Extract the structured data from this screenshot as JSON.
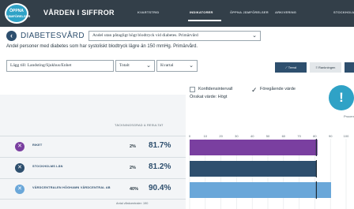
{
  "brand": {
    "logo_line1": "ÖPPNA",
    "logo_line2": "JÄMFÖRELSER"
  },
  "header": {
    "title": "VÅRDEN I SIFFROR",
    "nav": [
      "KVARTSTRID",
      "INDIKATORER",
      "ÖPPNA JÄMFÖRELSER",
      "ARKIVERING",
      "STOCKHOLMS"
    ]
  },
  "page": {
    "title": "DIABETESVÅRD",
    "indicator": "Andel utan påtagligt högt blodtryck vid diabetes. Primärvård",
    "subtitle": "Andel personer med diabetes som har systoliskt blodtryck lägre än 150 mmHg. Primärvård."
  },
  "filters": {
    "unit_placeholder": "Lägg till: Landsting/Sjukhus/Enhet",
    "gender": "Totalt",
    "period": "Kvartal"
  },
  "toolbar": {
    "trend_label": "Trend",
    "ranking_label": "Rankningen"
  },
  "options": {
    "confidence_label": "Konfidensintervall",
    "previous_label": "Föregående värde",
    "desired_value": "Önskat värde: Högt",
    "info_glyph": "!"
  },
  "table": {
    "column_header": "TÄCKNINGSGRAD & RESULTAT",
    "rows": [
      {
        "label": "RIKET",
        "share": "2%",
        "value": "81.7%",
        "color": "#7a3fa0",
        "icon": "close-icon"
      },
      {
        "label": "STOCKHOLMS LÄN",
        "share": "2%",
        "value": "81.2%",
        "color": "#2e4f6e",
        "icon": "close-icon"
      },
      {
        "label": "VÅRDCENTRALEN HÖGHAMN VÅRDCENTRAL AB",
        "share": "40%",
        "value": "90.4%",
        "color": "#6aa7d9",
        "icon": "close-icon"
      }
    ],
    "footnote": "Antal vårdcentraler: 190"
  },
  "chart_data": {
    "type": "bar",
    "orientation": "horizontal",
    "categories": [
      "RIKET",
      "STOCKHOLMS LÄN",
      "VÅRDCENTRALEN HÖGHAMN VÅRDCENTRAL AB"
    ],
    "values": [
      81.7,
      81.2,
      90.4
    ],
    "previous_values": [
      81.0,
      81.0,
      81.0
    ],
    "xlim": [
      0,
      100
    ],
    "ticks": [
      0,
      10,
      20,
      30,
      40,
      50,
      60,
      70,
      80,
      90,
      100
    ],
    "xlabel": "Procent",
    "colors": [
      "#7a3fa0",
      "#2e4f6e",
      "#6aa7d9"
    ]
  }
}
